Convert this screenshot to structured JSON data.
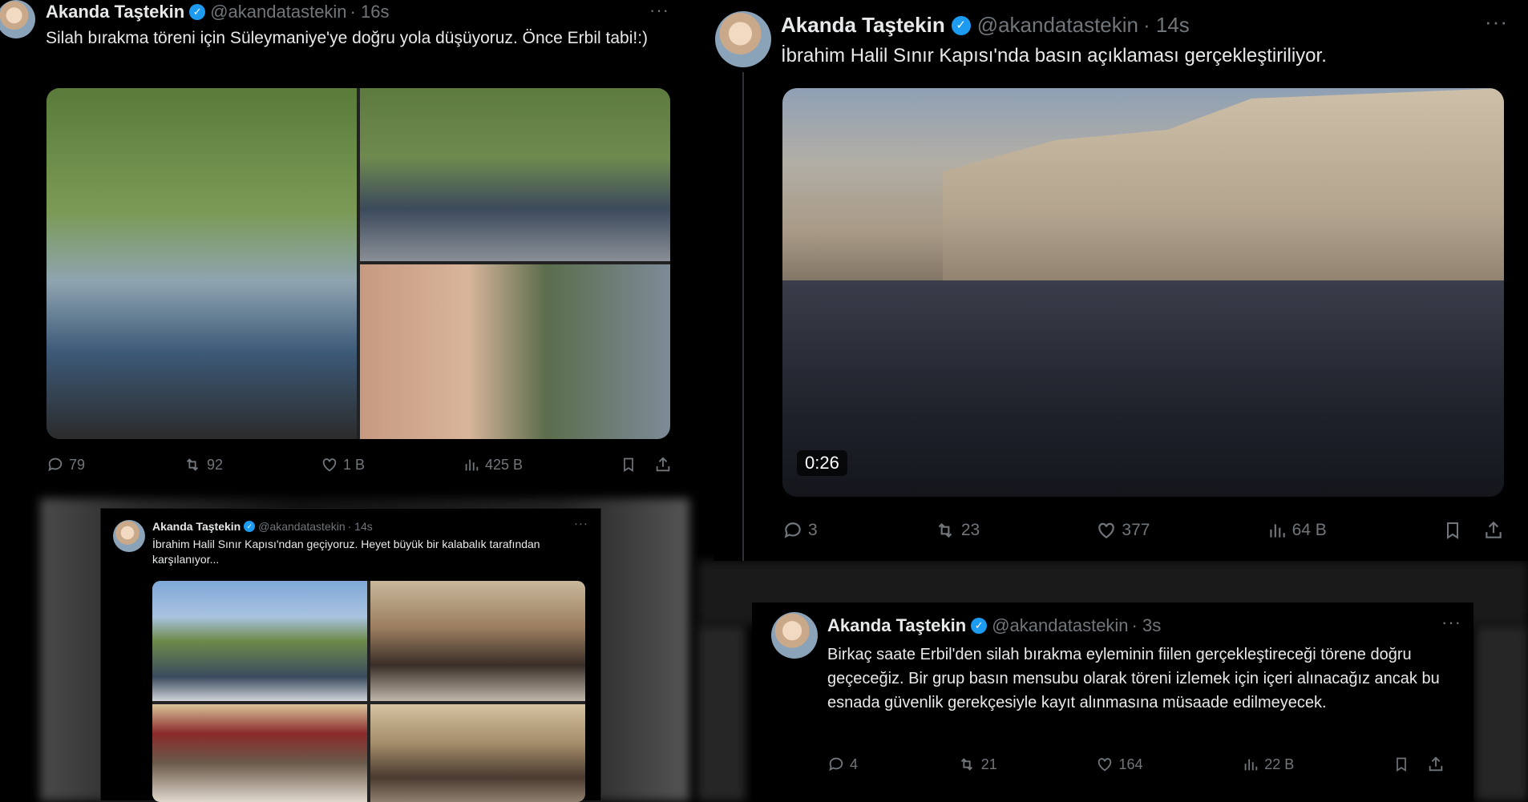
{
  "colors": {
    "background": "#000000",
    "accent": "#1d9bf0",
    "muted": "#71767b",
    "text": "#e7e9ea"
  },
  "tweets": [
    {
      "name": "Akanda Taştekin",
      "handle": "@akandatastekin",
      "time": "· 16s",
      "text": "Silah bırakma töreni için Süleymaniye'ye doğru yola düşüyoruz. Önce Erbil tabi!:)",
      "replies": "79",
      "retweets": "92",
      "likes": "1 B",
      "views": "425 B"
    },
    {
      "name": "Akanda Taştekin",
      "handle": "@akandatastekin",
      "time": "· 14s",
      "text": "İbrahim Halil Sınır Kapısı'nda basın açıklaması gerçekleştiriliyor.",
      "video_duration": "0:26",
      "replies": "3",
      "retweets": "23",
      "likes": "377",
      "views": "64 B"
    },
    {
      "name": "Akanda Taştekin",
      "handle": "@akandatastekin",
      "time": "· 14s",
      "text": "İbrahim Halil Sınır Kapısı'ndan geçiyoruz. Heyet büyük bir kalabalık tarafından karşılanıyor..."
    },
    {
      "name": "Akanda Taştekin",
      "handle": "@akandatastekin",
      "time": "· 3s",
      "text": "Birkaç saate Erbil'den silah bırakma eyleminin fiilen gerçekleştireceği törene doğru geçeceğiz. Bir grup basın mensubu olarak töreni izlemek için içeri alınacağız ancak bu esnada güvenlik gerekçesiyle kayıt alınmasına müsaade edilmeyecek.",
      "replies": "4",
      "retweets": "21",
      "likes": "164",
      "views": "22 B"
    }
  ]
}
